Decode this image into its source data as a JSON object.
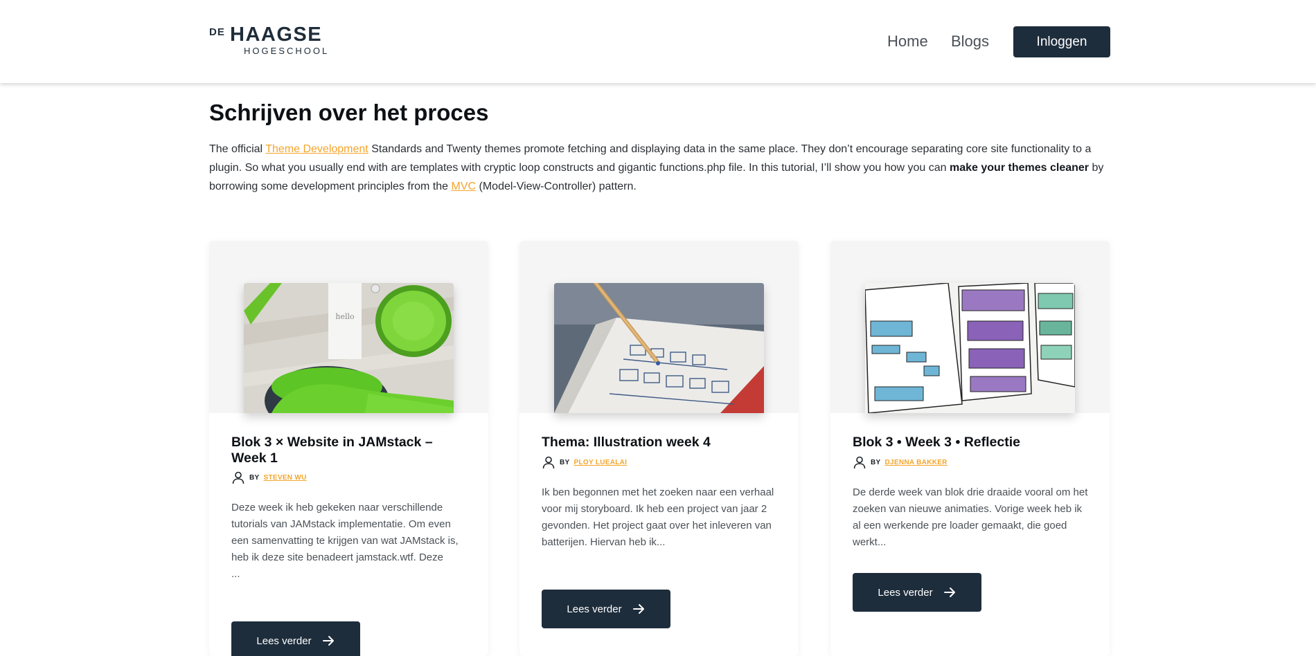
{
  "header": {
    "logo": {
      "de": "DE",
      "haagse": "HAAGSE",
      "hogeschool": "HOGESCHOOL"
    },
    "nav": {
      "home": "Home",
      "blogs": "Blogs"
    },
    "login_label": "Inloggen"
  },
  "intro": {
    "title": "Schrijven over het proces",
    "p_start": "The official ",
    "link_theme": "Theme Development",
    "p_mid1": " Standards and Twenty themes promote fetching and displaying data in the same place. They don’t encourage separating core site functionality to a plugin. So what you usually end with are templates with cryptic loop constructs and gigantic functions.php file. In this tutorial, I’ll show you how you can ",
    "bold": "make your themes cleaner",
    "p_mid2": " by borrowing some development principles from the ",
    "link_mvc": "MVC",
    "p_end": " (Model-View-Controller) pattern."
  },
  "cards": [
    {
      "title": "Blok 3 × Website in JAMstack – Week 1",
      "by": "BY",
      "author": "Steven Wu",
      "excerpt": "Deze week ik heb gekeken naar verschillende tutorials van JAMstack implementatie. Om even een samenvatting te krijgen van wat JAMstack is, heb ik deze site benadeert jamstack.wtf. Deze",
      "ellipsis": "...",
      "read_more": "Lees verder"
    },
    {
      "title": "Thema: Illustration week 4",
      "by": "BY",
      "author": "Ploy Luealai",
      "excerpt": "Ik ben begonnen met het zoeken naar een verhaal voor mij storyboard. Ik heb een project van jaar 2 gevonden. Het project gaat over het inleveren van batterijen. Hiervan heb ik...",
      "read_more": "Lees verder"
    },
    {
      "title": "Blok 3 • Week 3 • Reflectie",
      "by": "BY",
      "author": "Djenna Bakker",
      "excerpt": "De derde week van blok drie draaide vooral om het zoeken van nieuwe animaties. Vorige week heb ik al een werkende pre loader gemaakt, die goed werkt...",
      "read_more": "Lees verder"
    }
  ],
  "colors": {
    "accent": "#f4a52c",
    "dark_button": "#1e2d3c",
    "card_image_bg": "#f5f5f5"
  }
}
